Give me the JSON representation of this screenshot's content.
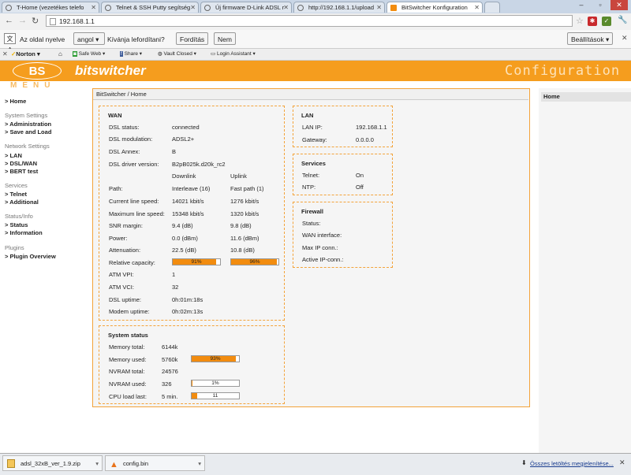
{
  "browser": {
    "tabs": [
      {
        "label": "T-Home (vezetékes telefo"
      },
      {
        "label": "Telnet & SSH Putty segítség"
      },
      {
        "label": "Új firmware D-Link ADSL r"
      },
      {
        "label": "http://192.168.1.1/upload"
      },
      {
        "label": "BitSwitcher Konfiguration"
      }
    ],
    "url": "192.168.1.1",
    "translate": {
      "page_lang_prefix": "Az oldal nyelve",
      "lang_select": "angol",
      "question": "Kívánja lefordítani?",
      "translate_btn": "Fordítás",
      "no_btn": "Nem",
      "settings_btn": "Beállítások"
    },
    "norton": {
      "norton": "Norton",
      "safe_web": "Safe Web",
      "share": "Share",
      "vault": "Vault Closed",
      "login": "Login Assistant"
    }
  },
  "header": {
    "logo": "BS",
    "brand": "bitswitcher",
    "page_title": "Configuration",
    "menu_label": "MENÜ"
  },
  "sidebar": {
    "home": "> Home",
    "sections": [
      {
        "title": "System Settings",
        "items": [
          "> Administration",
          "> Save and Load"
        ]
      },
      {
        "title": "Network Settings",
        "items": [
          "> LAN",
          "> DSL/WAN",
          "> BERT test"
        ]
      },
      {
        "title": "Services",
        "items": [
          "> Telnet",
          "> Additional"
        ]
      },
      {
        "title": "Status/Info",
        "items": [
          "> Status",
          "> Information"
        ]
      },
      {
        "title": "Plugins",
        "items": [
          "> Plugin Overview"
        ]
      }
    ]
  },
  "breadcrumb": "BitSwitcher / Home",
  "wan": {
    "title": "WAN",
    "dsl_status_label": "DSL status:",
    "dsl_status": "connected",
    "dsl_mod_label": "DSL modulation:",
    "dsl_mod": "ADSL2+",
    "dsl_annex_label": "DSL Annex:",
    "dsl_annex": "B",
    "dsl_driver_label": "DSL driver version:",
    "dsl_driver": "B2pB025k.d20k_rc2",
    "col_down": "Downlink",
    "col_up": "Uplink",
    "rows": [
      {
        "label": "Path:",
        "down": "Interleave (16)",
        "up": "Fast path (1)"
      },
      {
        "label": "Current line speed:",
        "down": "14021 kbit/s",
        "up": "1276 kbit/s"
      },
      {
        "label": "Maximum line speed:",
        "down": "15348 kbit/s",
        "up": "1320 kbit/s"
      },
      {
        "label": "SNR margin:",
        "down": "9.4 (dB)",
        "up": "9.8 (dB)"
      },
      {
        "label": "Power:",
        "down": "0.0 (dBm)",
        "up": "11.6 (dBm)"
      },
      {
        "label": "Attenuation:",
        "down": "22.5 (dB)",
        "up": "10.8 (dB)"
      }
    ],
    "rel_cap_label": "Relative capacity:",
    "rel_cap_down": "91%",
    "rel_cap_down_pct": 91,
    "rel_cap_up": "96%",
    "rel_cap_up_pct": 96,
    "atm_vpi_label": "ATM VPI:",
    "atm_vpi": "1",
    "atm_vci_label": "ATM VCI:",
    "atm_vci": "32",
    "dsl_uptime_label": "DSL uptime:",
    "dsl_uptime": "0h:01m:18s",
    "modem_uptime_label": "Modem uptime:",
    "modem_uptime": "0h:02m:13s"
  },
  "system": {
    "title": "System status",
    "mem_total_label": "Memory total:",
    "mem_total": "6144k",
    "mem_used_label": "Memory used:",
    "mem_used": "5760k",
    "mem_used_bar": "93%",
    "mem_used_pct": 93,
    "nvram_total_label": "NVRAM total:",
    "nvram_total": "24576",
    "nvram_used_label": "NVRAM used:",
    "nvram_used": "326",
    "nvram_used_bar": "1%",
    "nvram_used_pct": 1,
    "cpu_label": "CPU load last:",
    "cpu_period": "5 min.",
    "cpu_bar": "11",
    "cpu_pct": 11
  },
  "lan": {
    "title": "LAN",
    "ip_label": "LAN IP:",
    "ip": "192.168.1.1",
    "gw_label": "Gateway:",
    "gw": "0.0.0.0"
  },
  "services": {
    "title": "Services",
    "telnet_label": "Telnet:",
    "telnet": "On",
    "ntp_label": "NTP:",
    "ntp": "Off"
  },
  "firewall": {
    "title": "Firewall",
    "status_label": "Status:",
    "wan_if_label": "WAN interface:",
    "max_ip_label": "Max IP conn.:",
    "active_ip_label": "Active IP-conn.:"
  },
  "right_panel": {
    "home": "Home"
  },
  "downloads": {
    "items": [
      "adsl_32xB_ver_1.9.zip",
      "config.bin"
    ],
    "show_all": "Összes letöltés megjelenítése..."
  }
}
